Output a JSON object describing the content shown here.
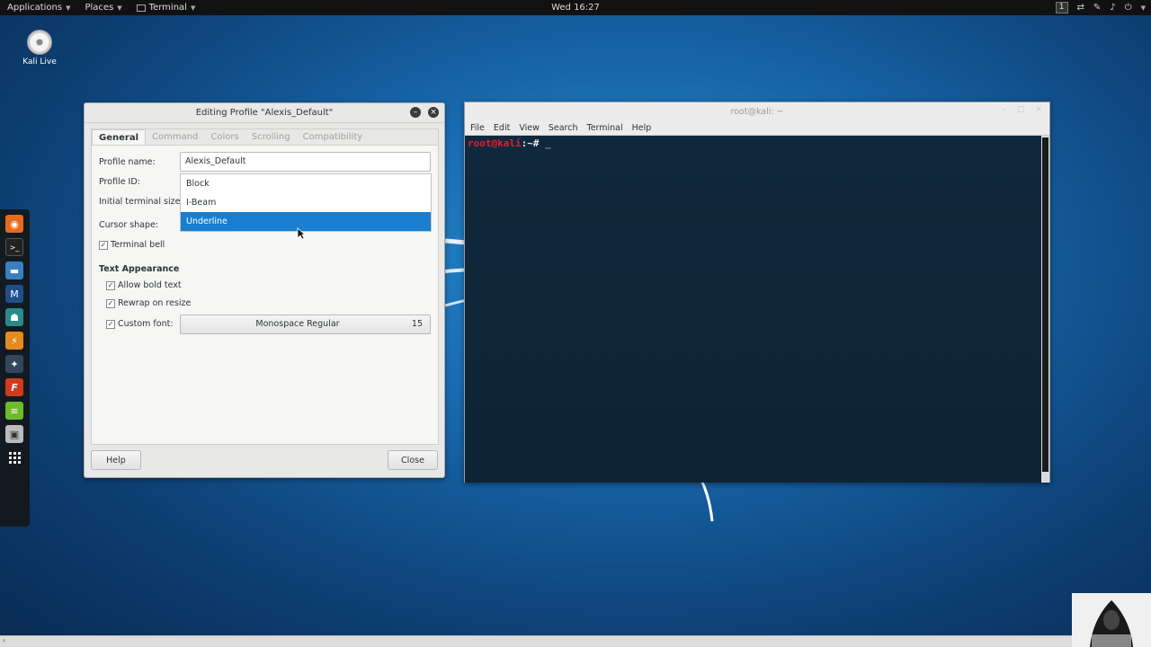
{
  "topbar": {
    "applications": "Applications",
    "places": "Places",
    "terminal": "Terminal",
    "clock": "Wed 16:27",
    "workspace": "1"
  },
  "desktop": {
    "icon_label": "Kali Live"
  },
  "dialog": {
    "title": "Editing Profile \"Alexis_Default\"",
    "tabs": [
      "General",
      "Command",
      "Colors",
      "Scrolling",
      "Compatibility"
    ],
    "profile_name_label": "Profile name:",
    "profile_name_value": "Alexis_Default",
    "profile_id_label": "Profile ID:",
    "initial_size_label": "Initial terminal size:",
    "cursor_shape_label": "Cursor shape:",
    "cursor_options": [
      "Block",
      "I-Beam",
      "Underline"
    ],
    "cursor_selected": "Underline",
    "terminal_bell_label": "Terminal bell",
    "text_appearance_label": "Text Appearance",
    "allow_bold_label": "Allow bold text",
    "rewrap_label": "Rewrap on resize",
    "custom_font_label": "Custom font:",
    "font_name": "Monospace Regular",
    "font_size": "15",
    "help_label": "Help",
    "close_label": "Close"
  },
  "terminal": {
    "title": "root@kali: ~",
    "menu": [
      "File",
      "Edit",
      "View",
      "Search",
      "Terminal",
      "Help"
    ],
    "prompt_user": "root@kali",
    "prompt_path": ":~#",
    "cursor": "_"
  },
  "colors": {
    "selection": "#1a7fd0",
    "prompt_red": "#e0202f",
    "terminal_bg": "#10283c"
  }
}
